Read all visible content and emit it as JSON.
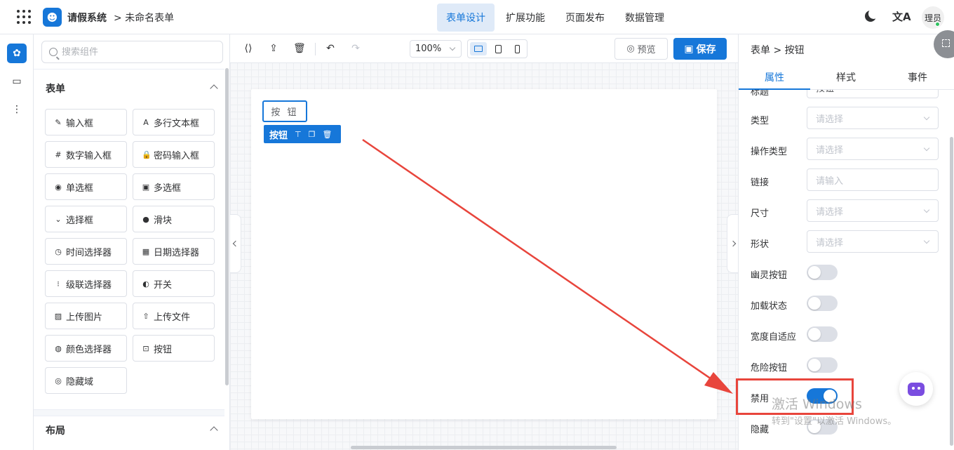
{
  "header": {
    "app_name": "请假系统",
    "breadcrumb": "> 未命名表单",
    "nav_tabs": [
      {
        "label": "表单设计",
        "active": true
      },
      {
        "label": "扩展功能",
        "active": false
      },
      {
        "label": "页面发布",
        "active": false
      },
      {
        "label": "数据管理",
        "active": false
      }
    ],
    "translate_glyph": "文A",
    "user_name": "理员",
    "accent_color": "#1677d9"
  },
  "left_rail": [
    "puzzle-icon",
    "form-icon",
    "flow-icon"
  ],
  "components": {
    "search_placeholder": "搜索组件",
    "section_form": "表单",
    "section_layout": "布局",
    "items": [
      {
        "label": "输入框",
        "icon": "✎"
      },
      {
        "label": "多行文本框",
        "icon": "A"
      },
      {
        "label": "数字输入框",
        "icon": "#"
      },
      {
        "label": "密码输入框",
        "icon": "🔒"
      },
      {
        "label": "单选框",
        "icon": "◉"
      },
      {
        "label": "多选框",
        "icon": "▣"
      },
      {
        "label": "选择框",
        "icon": "⌄"
      },
      {
        "label": "滑块",
        "icon": "●"
      },
      {
        "label": "时间选择器",
        "icon": "◷"
      },
      {
        "label": "日期选择器",
        "icon": "▦"
      },
      {
        "label": "级联选择器",
        "icon": "⁝"
      },
      {
        "label": "开关",
        "icon": "◐"
      },
      {
        "label": "上传图片",
        "icon": "▨"
      },
      {
        "label": "上传文件",
        "icon": "⇧"
      },
      {
        "label": "颜色选择器",
        "icon": "◍"
      },
      {
        "label": "按钮",
        "icon": "⊡"
      },
      {
        "label": "隐藏域",
        "icon": "◎"
      }
    ]
  },
  "canvas": {
    "zoom": "100%",
    "preview_label": "预览",
    "save_label": "保存",
    "demo_button_text": "按 钮",
    "selected_label": "按钮"
  },
  "properties": {
    "header_path": "表单 > 按钮",
    "tabs": [
      {
        "label": "属性",
        "active": true
      },
      {
        "label": "样式",
        "active": false
      },
      {
        "label": "事件",
        "active": false
      }
    ],
    "partial_row": {
      "label": "标题",
      "value": "按钮"
    },
    "fields": [
      {
        "label": "类型",
        "placeholder": "请选择",
        "kind": "select"
      },
      {
        "label": "操作类型",
        "placeholder": "请选择",
        "kind": "select"
      },
      {
        "label": "链接",
        "placeholder": "请输入",
        "kind": "input"
      },
      {
        "label": "尺寸",
        "placeholder": "请选择",
        "kind": "select"
      },
      {
        "label": "形状",
        "placeholder": "请选择",
        "kind": "select"
      }
    ],
    "switches": [
      {
        "label": "幽灵按钮",
        "on": false
      },
      {
        "label": "加载状态",
        "on": false
      },
      {
        "label": "宽度自适应",
        "on": false
      },
      {
        "label": "危险按钮",
        "on": false
      },
      {
        "label": "禁用",
        "on": true
      },
      {
        "label": "隐藏",
        "on": false
      }
    ]
  },
  "overlay": {
    "watermark_title": "激活 Windows",
    "watermark_sub": "转到\"设置\"以激活 Windows。",
    "highlight_color": "#e8453c"
  }
}
